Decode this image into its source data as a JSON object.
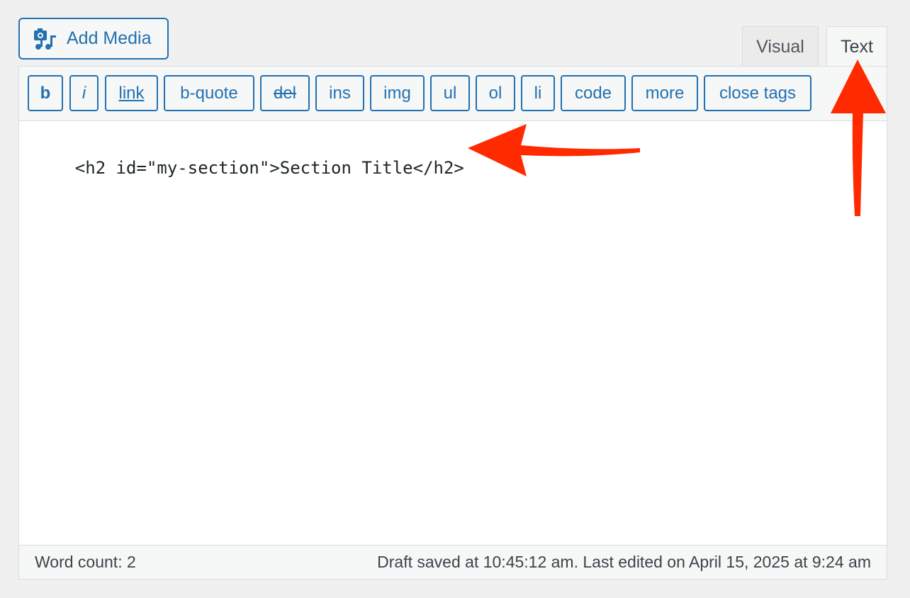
{
  "header": {
    "add_media_label": "Add Media",
    "add_media_icon": "media-camera-music-icon"
  },
  "tabs": {
    "visual": "Visual",
    "text": "Text",
    "active": "Text"
  },
  "toolbar": {
    "buttons": [
      "b",
      "i",
      "link",
      "b-quote",
      "del",
      "ins",
      "img",
      "ul",
      "ol",
      "li",
      "code",
      "more",
      "close tags"
    ]
  },
  "editor": {
    "content": "<h2 id=\"my-section\">Section Title</h2>"
  },
  "status": {
    "word_count": "Word count: 2",
    "draft_saved": "Draft saved at 10:45:12 am. Last edited on April 15, 2025 at 9:24 am"
  },
  "annotations": {
    "arrow_color": "#ff2a00",
    "arrows": [
      "arrow-pointing-to-code",
      "arrow-pointing-to-text-tab"
    ]
  },
  "colors": {
    "accent": "#2271b1",
    "background": "#f0f0f1"
  }
}
